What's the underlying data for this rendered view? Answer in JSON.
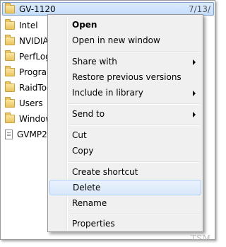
{
  "explorer": {
    "selected": {
      "name": "GV-1120",
      "date": "7/13/"
    },
    "items": [
      {
        "name": "Intel",
        "type": "folder"
      },
      {
        "name": "NVIDIA",
        "type": "folder"
      },
      {
        "name": "PerfLog",
        "type": "folder"
      },
      {
        "name": "Program",
        "type": "folder"
      },
      {
        "name": "RaidToo",
        "type": "folder"
      },
      {
        "name": "Users",
        "type": "folder"
      },
      {
        "name": "Window",
        "type": "folder"
      },
      {
        "name": "GVMP2",
        "type": "file"
      }
    ]
  },
  "context_menu": {
    "items": [
      {
        "label": "Open",
        "bold": true
      },
      {
        "label": "Open in new window"
      },
      {
        "label": "Share with",
        "submenu": true
      },
      {
        "label": "Restore previous versions"
      },
      {
        "label": "Include in library",
        "submenu": true
      },
      {
        "label": "Send to",
        "submenu": true
      },
      {
        "label": "Cut"
      },
      {
        "label": "Copy"
      },
      {
        "label": "Create shortcut"
      },
      {
        "label": "Delete",
        "highlighted": true
      },
      {
        "label": "Rename"
      },
      {
        "label": "Properties"
      }
    ]
  },
  "watermark": "TSM"
}
